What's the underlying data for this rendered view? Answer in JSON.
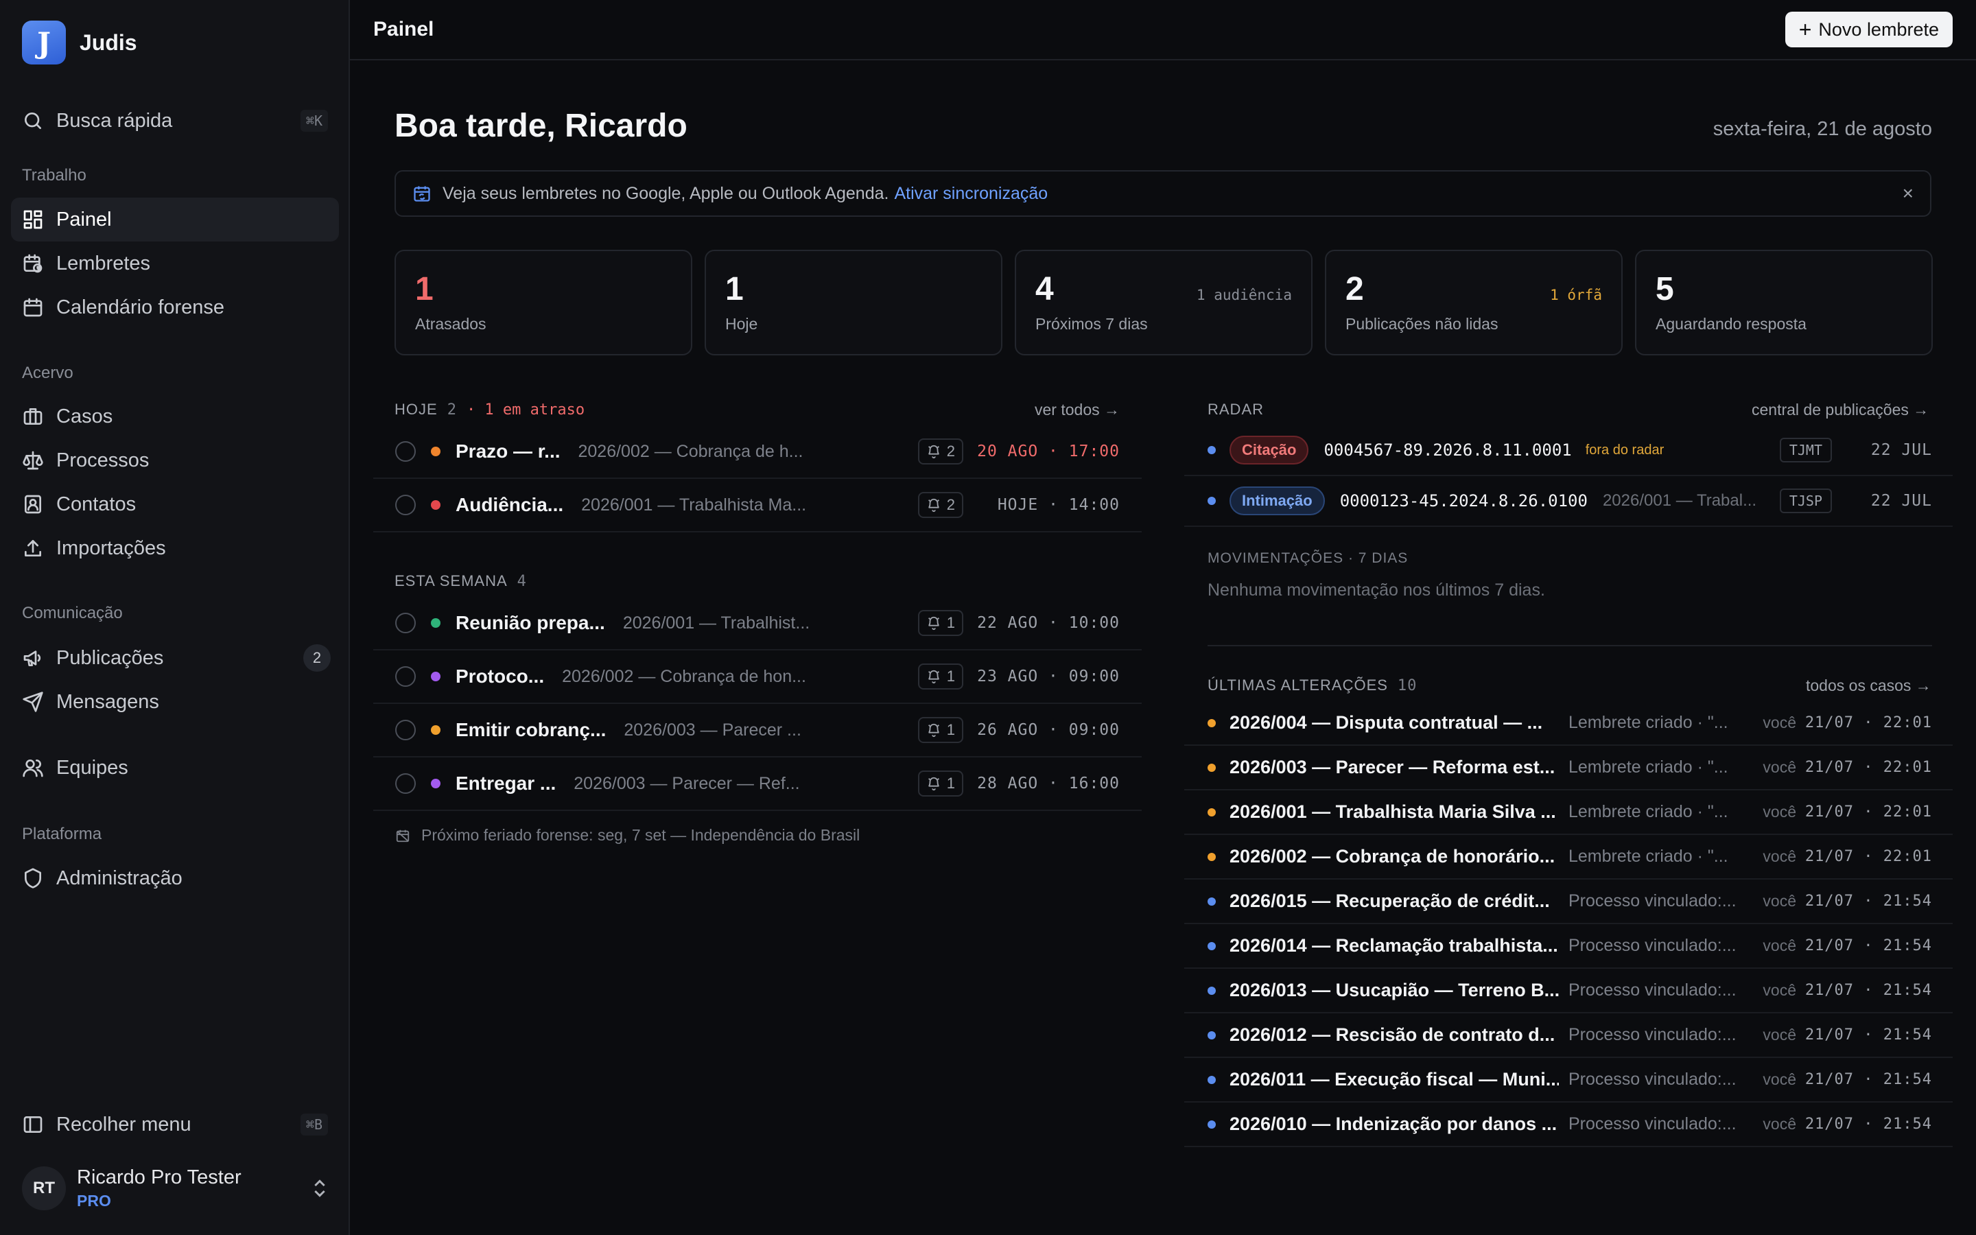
{
  "brand": {
    "name": "Judis",
    "logo_letter": "J"
  },
  "sidebar": {
    "search": {
      "label": "Busca rápida",
      "shortcut": "⌘K"
    },
    "sections": {
      "trabalho": "Trabalho",
      "acervo": "Acervo",
      "comunicacao": "Comunicação",
      "plataforma": "Plataforma"
    },
    "items": {
      "painel": "Painel",
      "lembretes": "Lembretes",
      "calendario": "Calendário forense",
      "casos": "Casos",
      "processos": "Processos",
      "contatos": "Contatos",
      "importacoes": "Importações",
      "publicacoes": "Publicações",
      "publicacoes_count": "2",
      "mensagens": "Mensagens",
      "equipes": "Equipes",
      "administracao": "Administração"
    },
    "collapse": {
      "label": "Recolher menu",
      "shortcut": "⌘B"
    },
    "user": {
      "initials": "RT",
      "name": "Ricardo Pro Tester",
      "plan": "PRO"
    }
  },
  "topbar": {
    "title": "Painel",
    "new_button": "Novo lembrete",
    "new_icon": "+"
  },
  "header": {
    "greeting": "Boa tarde, Ricardo",
    "date": "sexta-feira, 21 de agosto"
  },
  "banner": {
    "text": "Veja seus lembretes no Google, Apple ou Outlook Agenda.",
    "link": "Ativar sincronização",
    "close": "×"
  },
  "stats": [
    {
      "value": "1",
      "label": "Atrasados",
      "note": ""
    },
    {
      "value": "1",
      "label": "Hoje",
      "note": ""
    },
    {
      "value": "4",
      "label": "Próximos 7 dias",
      "note": "1 audiência"
    },
    {
      "value": "2",
      "label": "Publicações não lidas",
      "note": "1 órfã"
    },
    {
      "value": "5",
      "label": "Aguardando resposta",
      "note": ""
    }
  ],
  "today": {
    "heading": "HOJE",
    "count": "2",
    "late": "· 1 em atraso",
    "link": "ver todos →",
    "tasks": [
      {
        "title": "Prazo — r...",
        "case": "2026/002 — Cobrança de h...",
        "bell": "2",
        "when": "20 AGO · 17:00",
        "color": "#f0852d"
      },
      {
        "title": "Audiência...",
        "case": "2026/001 — Trabalhista Ma...",
        "bell": "2",
        "when": "HOJE · 14:00",
        "color": "#e5484d"
      }
    ]
  },
  "week": {
    "heading": "ESTA SEMANA",
    "count": "4",
    "tasks": [
      {
        "title": "Reunião prepa...",
        "case": "2026/001 — Trabalhist...",
        "bell": "1",
        "when": "22 AGO · 10:00",
        "color": "#2fb37a"
      },
      {
        "title": "Protoco...",
        "case": "2026/002 — Cobrança de hon...",
        "bell": "1",
        "when": "23 AGO · 09:00",
        "color": "#a35bef"
      },
      {
        "title": "Emitir cobranç...",
        "case": "2026/003 — Parecer ...",
        "bell": "1",
        "when": "26 AGO · 09:00",
        "color": "#f0a02d"
      },
      {
        "title": "Entregar ...",
        "case": "2026/003 — Parecer — Ref...",
        "bell": "1",
        "when": "28 AGO · 16:00",
        "color": "#a35bef"
      }
    ]
  },
  "holiday": "Próximo feriado forense: seg, 7 set — Independência do Brasil",
  "radar": {
    "heading": "RADAR",
    "link": "central de publicações →",
    "items": [
      {
        "type": "Citação",
        "number": "0004567-89.2026.8.11.0001",
        "tag": "fora do radar",
        "sub": "",
        "court": "TJMT",
        "date": "22 JUL"
      },
      {
        "type": "Intimação",
        "number": "0000123-45.2024.8.26.0100",
        "tag": "",
        "sub": "2026/001 — Trabal...",
        "court": "TJSP",
        "date": "22 JUL"
      }
    ]
  },
  "movements": {
    "heading": "MOVIMENTAÇÕES · 7 DIAS",
    "empty": "Nenhuma movimentação nos últimos 7 dias."
  },
  "changes": {
    "heading": "ÚLTIMAS ALTERAÇÕES",
    "count": "10",
    "link": "todos os casos →",
    "items": [
      {
        "title": "2026/004 — Disputa contratual — ...",
        "desc": "Lembrete criado · \"...",
        "who": "você",
        "when": "21/07 · 22:01",
        "color": "#f0a02d"
      },
      {
        "title": "2026/003 — Parecer — Reforma est...",
        "desc": "Lembrete criado · \"...",
        "who": "você",
        "when": "21/07 · 22:01",
        "color": "#f0a02d"
      },
      {
        "title": "2026/001 — Trabalhista Maria Silva ...",
        "desc": "Lembrete criado · \"...",
        "who": "você",
        "when": "21/07 · 22:01",
        "color": "#f0a02d"
      },
      {
        "title": "2026/002 — Cobrança de honorário...",
        "desc": "Lembrete criado · \"...",
        "who": "você",
        "when": "21/07 · 22:01",
        "color": "#f0a02d"
      },
      {
        "title": "2026/015 — Recuperação de crédit...",
        "desc": "Processo vinculado:...",
        "who": "você",
        "when": "21/07 · 21:54",
        "color": "#5b8def"
      },
      {
        "title": "2026/014 — Reclamação trabalhista...",
        "desc": "Processo vinculado:...",
        "who": "você",
        "when": "21/07 · 21:54",
        "color": "#5b8def"
      },
      {
        "title": "2026/013 — Usucapião — Terreno B...",
        "desc": "Processo vinculado:...",
        "who": "você",
        "when": "21/07 · 21:54",
        "color": "#5b8def"
      },
      {
        "title": "2026/012 — Rescisão de contrato d...",
        "desc": "Processo vinculado:...",
        "who": "você",
        "when": "21/07 · 21:54",
        "color": "#5b8def"
      },
      {
        "title": "2026/011 — Execução fiscal — Muni...",
        "desc": "Processo vinculado:...",
        "who": "você",
        "when": "21/07 · 21:54",
        "color": "#5b8def"
      },
      {
        "title": "2026/010 — Indenização por danos ...",
        "desc": "Processo vinculado:...",
        "who": "você",
        "when": "21/07 · 21:54",
        "color": "#5b8def"
      }
    ]
  }
}
